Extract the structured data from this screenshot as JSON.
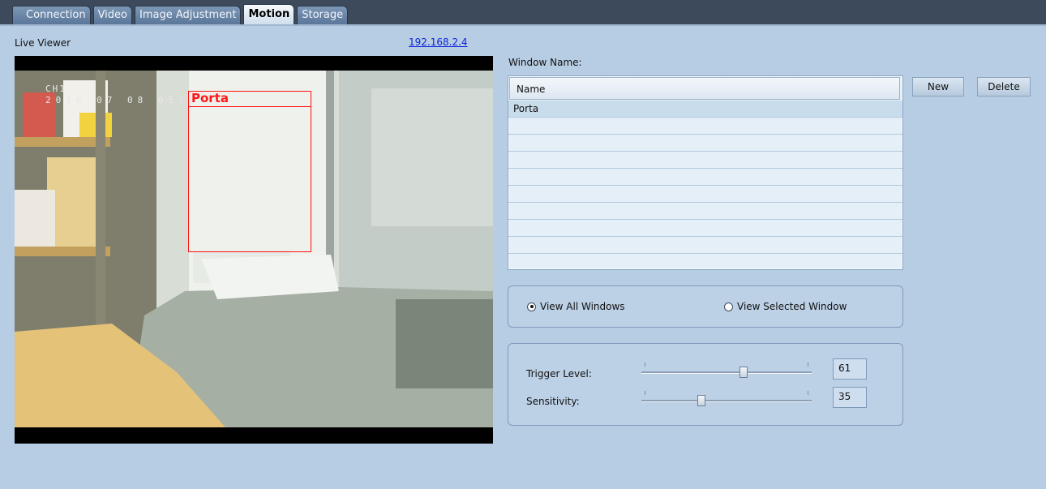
{
  "tabs": [
    {
      "label": "Connection"
    },
    {
      "label": "Video"
    },
    {
      "label": "Image Adjustment"
    },
    {
      "label": "Motion"
    },
    {
      "label": "Storage"
    }
  ],
  "viewer": {
    "title": "Live Viewer",
    "ip": "192.168.2.4",
    "osd_channel": "CH1",
    "osd_datetime": "2010 07 08 05:5",
    "motion_window_label": "Porta"
  },
  "window_panel": {
    "label": "Window Name:",
    "column_header": "Name",
    "rows": [
      "Porta"
    ],
    "new_label": "New",
    "delete_label": "Delete"
  },
  "view_mode": {
    "all_label": "View All Windows",
    "selected_label": "View Selected Window",
    "selected": "all"
  },
  "controls": {
    "trigger_label": "Trigger Level:",
    "trigger_value": "61",
    "sensitivity_label": "Sensitivity:",
    "sensitivity_value": "35"
  }
}
